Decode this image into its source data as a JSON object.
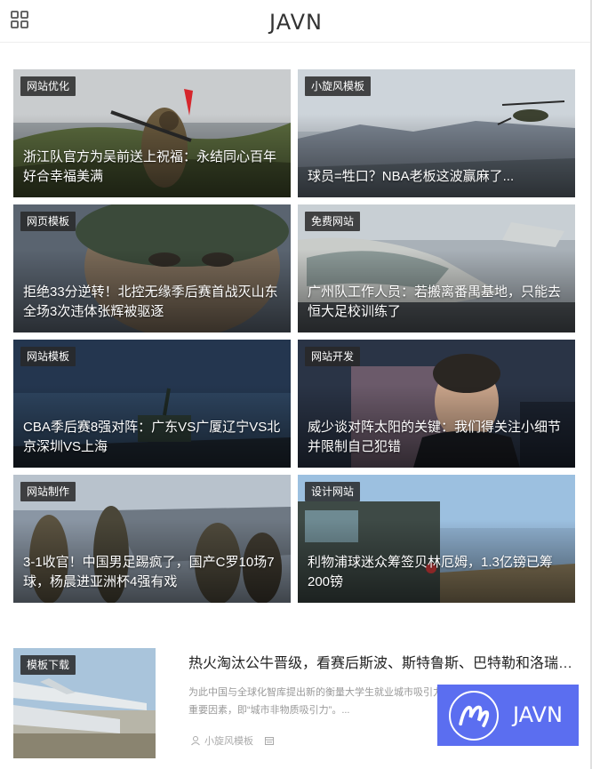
{
  "header": {
    "logo": "JAVN"
  },
  "cards": [
    {
      "tag": "网站优化",
      "title": "浙江队官方为吴前送上祝福：永结同心百年好合幸福美满"
    },
    {
      "tag": "小旋风模板",
      "title": "球员=牲口？NBA老板这波赢麻了..."
    },
    {
      "tag": "网页模板",
      "title": "拒绝33分逆转！北控无缘季后赛首战灭山东 全场3次违体张辉被驱逐"
    },
    {
      "tag": "免费网站",
      "title": "广州队工作人员：若搬离番禺基地，只能去恒大足校训练了"
    },
    {
      "tag": "网站模板",
      "title": "CBA季后赛8强对阵：广东VS广厦辽宁VS北京深圳VS上海"
    },
    {
      "tag": "网站开发",
      "title": "威少谈对阵太阳的关键：我们得关注小细节 并限制自己犯错"
    },
    {
      "tag": "网站制作",
      "title": "3-1收官！中国男足踢疯了，国产C罗10场7球，杨晨进亚洲杯4强有戏"
    },
    {
      "tag": "设计网站",
      "title": "利物浦球迷众筹签贝林厄姆，1.3亿镑已筹200镑"
    }
  ],
  "post": {
    "tag": "模板下载",
    "title": "热火淘汰公牛晋级，看赛后斯波、斯特鲁斯、巴特勒和洛瑞怎么说",
    "excerpt": "为此中国与全球化智库提出新的衡量大学生就业城市吸引力的重要因素，即“城市非物质吸引力”。...",
    "author": "小旋风模板"
  },
  "badge": {
    "text": "JAVN"
  }
}
